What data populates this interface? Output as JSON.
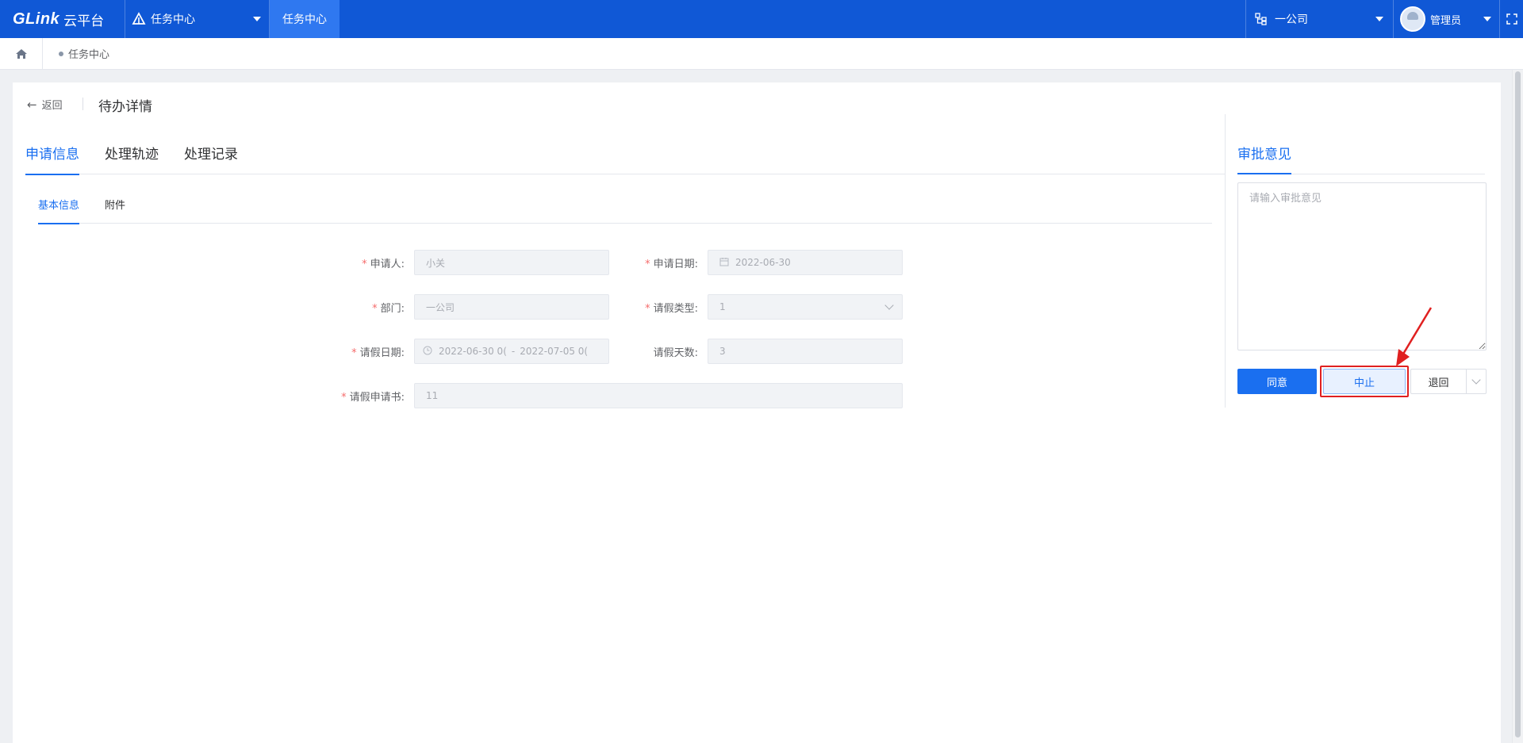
{
  "topbar": {
    "brand": "GLink",
    "brand_suffix": "云平台",
    "system_select": "任务中心",
    "active_tab": "任务中心",
    "org_select": "一公司",
    "user_name": "管理员"
  },
  "breadcrumb": {
    "current": "任务中心"
  },
  "header": {
    "back_label": "返回",
    "title": "待办详情"
  },
  "tabs": [
    "申请信息",
    "处理轨迹",
    "处理记录"
  ],
  "subtabs": [
    "基本信息",
    "附件"
  ],
  "form": {
    "applicant": {
      "label": "申请人:",
      "value": "小关"
    },
    "apply_date": {
      "label": "申请日期:",
      "value": "2022-06-30"
    },
    "department": {
      "label": "部门:",
      "value": "一公司"
    },
    "leave_type": {
      "label": "请假类型:",
      "value": "1"
    },
    "leave_date": {
      "label": "请假日期:",
      "start": "2022-06-30 0(",
      "separator": "-",
      "end": "2022-07-05 0("
    },
    "leave_days": {
      "label": "请假天数:",
      "value": "3"
    },
    "leave_letter": {
      "label": "请假申请书:",
      "value": "11"
    }
  },
  "approval": {
    "title": "审批意见",
    "placeholder": "请输入审批意见",
    "agree_label": "同意",
    "stop_label": "中止",
    "return_label": "退回"
  },
  "colors": {
    "brand": "#1058d6",
    "accent": "#1a6ff0",
    "highlight": "#e02020"
  }
}
